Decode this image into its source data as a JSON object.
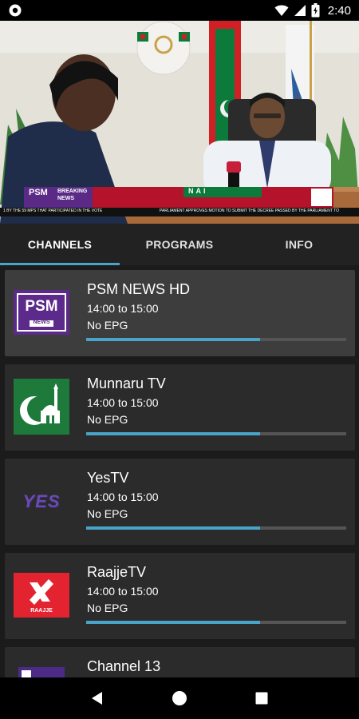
{
  "status_bar": {
    "time": "2:40",
    "icons": [
      "circle-app-icon",
      "wifi-icon",
      "signal-icon",
      "battery-charging-icon"
    ]
  },
  "video": {
    "ticker_brand": "PSM",
    "ticker_tag": "BREAKING NEWS",
    "banner_label": "NAI",
    "ticker_text": "PARLIAMENT APPROVES MOTION TO SUBMIT THE DECREE PASSED BY THE PARLIAMENT TO",
    "ticker_text_left": "1 BY THE 59 MPS THAT PARTICIPATED IN THE VOTE"
  },
  "tabs": [
    {
      "label": "CHANNELS",
      "active": true
    },
    {
      "label": "PROGRAMS",
      "active": false
    },
    {
      "label": "INFO",
      "active": false
    }
  ],
  "channels": [
    {
      "name": "PSM NEWS HD",
      "time": "14:00 to 15:00",
      "epg": "No EPG",
      "progress": 0.67,
      "logo": "psm-news-logo",
      "logo_text": "PSM",
      "logo_sub": "NEWS",
      "selected": true
    },
    {
      "name": "Munnaru TV",
      "time": "14:00 to 15:00",
      "epg": "No EPG",
      "progress": 0.67,
      "logo": "munnaru-mosque-logo",
      "selected": false
    },
    {
      "name": "YesTV",
      "time": "14:00 to 15:00",
      "epg": "No EPG",
      "progress": 0.67,
      "logo": "yes-tv-logo",
      "logo_text": "YES",
      "selected": false
    },
    {
      "name": "RaajjeTV",
      "time": "14:00 to 15:00",
      "epg": "No EPG",
      "progress": 0.67,
      "logo": "raajje-tv-logo",
      "logo_text": "RAAJJE",
      "selected": false
    },
    {
      "name": "Channel 13",
      "time": "",
      "epg": "",
      "progress": 0,
      "logo": "channel-13-logo",
      "selected": false
    }
  ],
  "navbar": {
    "icons": [
      "back-icon",
      "home-icon",
      "recents-icon"
    ]
  },
  "colors": {
    "accent": "#4aa3c8",
    "card": "#2b2b2b",
    "card_selected": "#3d3d3d",
    "background": "#1b1b1b"
  }
}
